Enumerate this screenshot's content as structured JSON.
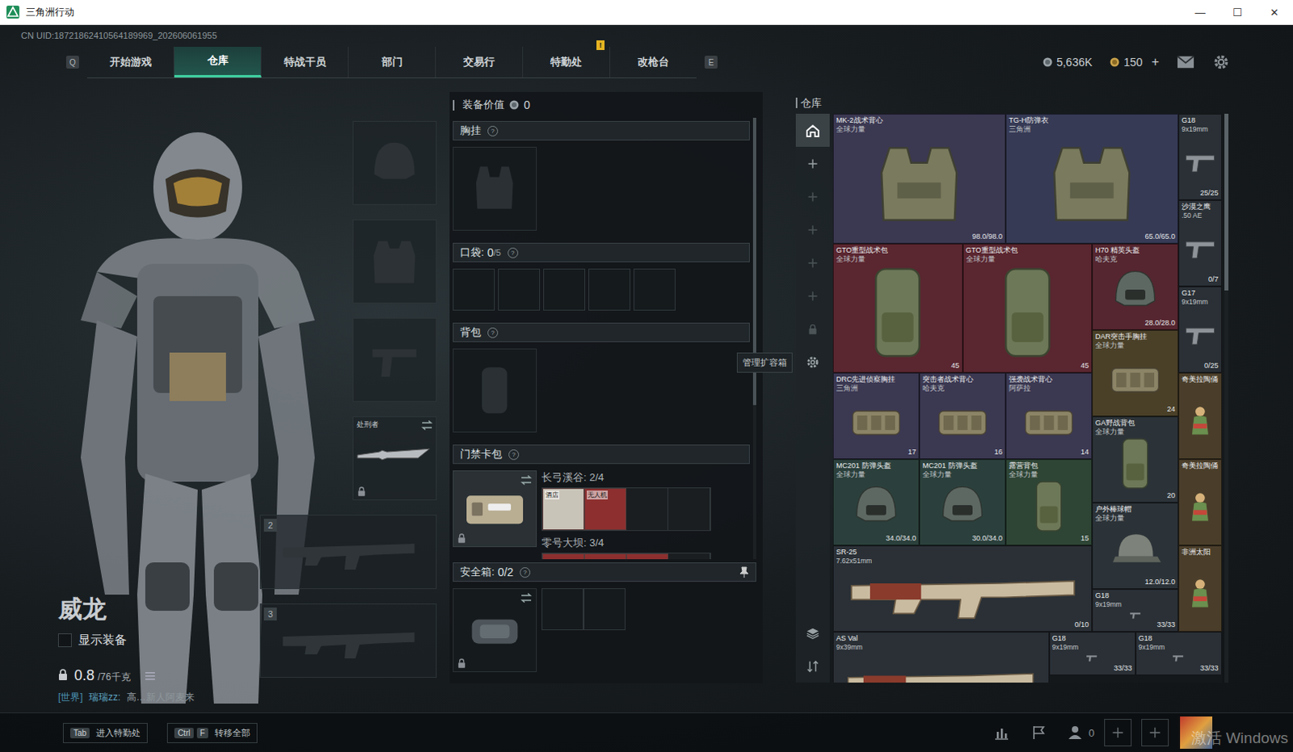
{
  "window": {
    "title": "三角洲行动",
    "controls": [
      "—",
      "☐",
      "✕"
    ]
  },
  "uid": "CN UID:18721862410564189969_202606061955",
  "nav": {
    "left_key": "Q",
    "right_key": "E",
    "tabs": [
      {
        "label": "开始游戏",
        "selected": false,
        "badge": ""
      },
      {
        "label": "仓库",
        "selected": true,
        "badge": ""
      },
      {
        "label": "特战干员",
        "selected": false,
        "badge": ""
      },
      {
        "label": "部门",
        "selected": false,
        "badge": ""
      },
      {
        "label": "交易行",
        "selected": false,
        "badge": ""
      },
      {
        "label": "特勤处",
        "selected": false,
        "badge": "!"
      },
      {
        "label": "改枪台",
        "selected": false,
        "badge": ""
      }
    ],
    "currencies": [
      {
        "kind": "coin",
        "amount": "5,636K",
        "action": ""
      },
      {
        "kind": "bond",
        "amount": "150",
        "action": "+"
      }
    ]
  },
  "operator": {
    "name": "威龙",
    "show_gear": {
      "label": "显示装备",
      "checked": false
    },
    "weight": "0.8",
    "weight_max": "/76千克",
    "chat": {
      "channel": "[世界]",
      "user": "瑞瑞zz:",
      "text": "高…新人阿麦来"
    }
  },
  "slots": [
    {
      "kind": "helmet",
      "label": "",
      "filled": false,
      "locked": false
    },
    {
      "kind": "armor",
      "label": "",
      "filled": false,
      "locked": false
    },
    {
      "kind": "pistol",
      "label": "",
      "filled": false,
      "locked": false
    },
    {
      "kind": "knife",
      "label": "处刑者",
      "filled": true,
      "locked": true
    },
    {
      "kind": "primary",
      "label": "2",
      "filled": false,
      "locked": false
    },
    {
      "kind": "primary",
      "label": "3",
      "filled": false,
      "locked": false
    }
  ],
  "loadout": {
    "value_label": "装备价值",
    "value": "0",
    "scroll": {
      "level": 0.65
    },
    "chest": {
      "title": "胸挂",
      "help": "?"
    },
    "pockets": {
      "title": "口袋:",
      "count": "0",
      "max": "/5",
      "help": "?",
      "slots": 5
    },
    "backpack": {
      "title": "背包",
      "help": "?"
    },
    "keycards": {
      "title": "门禁卡包",
      "help": "?",
      "locked": true,
      "maps": [
        {
          "name": "长弓溪谷: 2/4",
          "cards": [
            {
              "label": "酒店",
              "filled": true,
              "color": "#c9c4b8"
            },
            {
              "label": "无人机",
              "filled": true,
              "color": "#8e2f2f"
            },
            {
              "label": "",
              "filled": false,
              "color": "#1a1e21"
            },
            {
              "label": "",
              "filled": false,
              "color": "#1a1e21"
            }
          ]
        },
        {
          "name": "零号大坝: 3/4",
          "cards": [
            {
              "label": "",
              "filled": true,
              "color": "#8e2f2f"
            },
            {
              "label": "",
              "filled": true,
              "color": "#8e2f2f"
            },
            {
              "label": "",
              "filled": true,
              "color": "#8e2f2f"
            },
            {
              "label": "",
              "filled": false,
              "color": "#1a1e21"
            }
          ]
        }
      ]
    },
    "safe": {
      "title": "安全箱:",
      "count": "0/2",
      "help": "?",
      "locked": true,
      "slots": 2
    }
  },
  "tooltip": "管理扩容箱",
  "warehouse": {
    "title": "仓库",
    "scroll": {
      "level": 0.31
    },
    "sidebar": [
      {
        "kind": "home",
        "selected": true,
        "dim": false
      },
      {
        "kind": "add",
        "selected": false,
        "dim": false
      },
      {
        "kind": "add",
        "selected": false,
        "dim": true
      },
      {
        "kind": "add",
        "selected": false,
        "dim": true
      },
      {
        "kind": "add",
        "selected": false,
        "dim": true
      },
      {
        "kind": "add",
        "selected": false,
        "dim": true
      },
      {
        "kind": "lock",
        "selected": false,
        "dim": true
      },
      {
        "kind": "gear",
        "selected": false,
        "dim": false
      },
      {
        "kind": "layers",
        "selected": false,
        "dim": false
      },
      {
        "kind": "sort",
        "selected": false,
        "dim": false
      }
    ],
    "items": [
      {
        "name": "MK-2战术背心",
        "sub": "全球力量",
        "value": "98.0/98.0",
        "kind": "vest",
        "color": "#3b3852"
      },
      {
        "name": "TG-H防弹衣",
        "sub": "三角洲",
        "value": "65.0/65.0",
        "kind": "vest",
        "color": "#363a55"
      },
      {
        "name": "G18",
        "sub": "9x19mm",
        "value": "25/25",
        "kind": "pistol",
        "color": "#2a3036"
      },
      {
        "name": "沙漠之鹰",
        "sub": ".50 AE",
        "value": "0/7",
        "kind": "pistol",
        "color": "#2a3036"
      },
      {
        "name": "GTO重型战术包",
        "sub": "全球力量",
        "value": "45",
        "kind": "backpack",
        "color": "#5a2630"
      },
      {
        "name": "GTO重型战术包",
        "sub": "全球力量",
        "value": "45",
        "kind": "backpack",
        "color": "#5a2630"
      },
      {
        "name": "H70 精英头盔",
        "sub": "哈夫克",
        "value": "28.0/28.0",
        "kind": "helmet",
        "color": "#552630"
      },
      {
        "name": "G17",
        "sub": "9x19mm",
        "value": "0/25",
        "kind": "pistol",
        "color": "#2a3036"
      },
      {
        "name": "DAR突击手胸挂",
        "sub": "全球力量",
        "value": "24",
        "kind": "rig",
        "color": "#4a4028"
      },
      {
        "name": "DRC先进侦察胸挂",
        "sub": "三角洲",
        "value": "17",
        "kind": "rig",
        "color": "#3b3852"
      },
      {
        "name": "突击者战术背心",
        "sub": "哈夫克",
        "value": "16",
        "kind": "rig",
        "color": "#3b3852"
      },
      {
        "name": "强袭战术背心",
        "sub": "阿萨拉",
        "value": "14",
        "kind": "rig",
        "color": "#3b3852"
      },
      {
        "name": "奇美拉陶俑",
        "sub": "",
        "value": "",
        "kind": "figurine",
        "color": "#4a3e2a"
      },
      {
        "name": "GA野战背包",
        "sub": "全球力量",
        "value": "20",
        "kind": "backpack",
        "color": "#2c3338"
      },
      {
        "name": "MC201 防弹头盔",
        "sub": "全球力量",
        "value": "34.0/34.0",
        "kind": "helmet",
        "color": "#2b403c"
      },
      {
        "name": "MC201 防弹头盔",
        "sub": "全球力量",
        "value": "30.0/34.0",
        "kind": "helmet",
        "color": "#2b403c"
      },
      {
        "name": "露营背包",
        "sub": "全球力量",
        "value": "15",
        "kind": "backpack",
        "color": "#2e4535"
      },
      {
        "name": "奇美拉陶俑",
        "sub": "",
        "value": "",
        "kind": "figurine",
        "color": "#4a3e2a"
      },
      {
        "name": "户外棒球帽",
        "sub": "全球力量",
        "value": "12.0/12.0",
        "kind": "cap",
        "color": "#2c3338"
      },
      {
        "name": "SR-25",
        "sub": "7.62x51mm",
        "value": "0/10",
        "kind": "rifle",
        "color": "#2a3036"
      },
      {
        "name": "非洲太阳",
        "sub": "",
        "value": "",
        "kind": "figurine",
        "color": "#4a3e2a"
      },
      {
        "name": "G18",
        "sub": "9x19mm",
        "value": "33/33",
        "kind": "pistol",
        "color": "#2a3036"
      },
      {
        "name": "AS Val",
        "sub": "9x39mm",
        "value": "",
        "kind": "rifle",
        "color": "#2a3036"
      },
      {
        "name": "G18",
        "sub": "9x19mm",
        "value": "33/33",
        "kind": "pistol",
        "color": "#2a3036"
      },
      {
        "name": "G18",
        "sub": "9x19mm",
        "value": "33/33",
        "kind": "pistol",
        "color": "#2a3036"
      }
    ]
  },
  "footer": {
    "hints": [
      {
        "keys": [
          "Tab"
        ],
        "label": "进入特勤处"
      },
      {
        "keys": [
          "Ctrl",
          "F"
        ],
        "label": "转移全部"
      }
    ],
    "friends": "0",
    "watermark": "激活 Windows"
  }
}
